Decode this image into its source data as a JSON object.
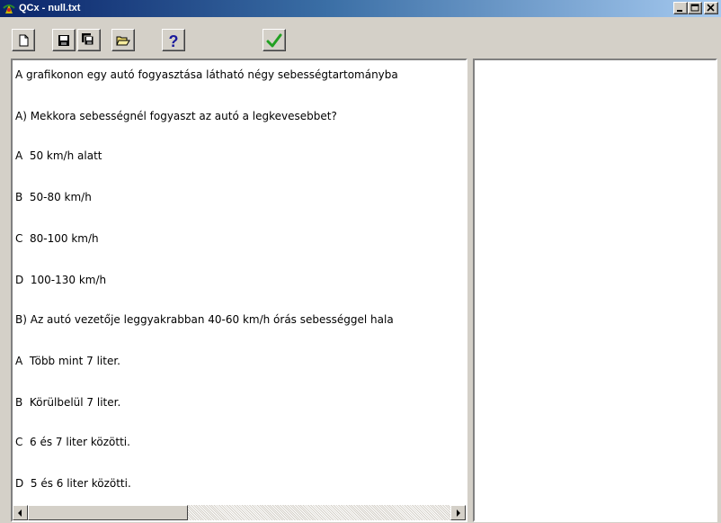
{
  "window": {
    "title": "QCx - null.txt"
  },
  "toolbar": {
    "buttons": [
      {
        "icon": "new-document-icon"
      },
      {
        "icon": "save-icon"
      },
      {
        "icon": "save-all-icon"
      },
      {
        "icon": "open-folder-icon"
      },
      {
        "icon": "help-icon",
        "color": "#1a1a9c"
      },
      {
        "icon": "checkmark-icon",
        "color": "#22a022"
      }
    ]
  },
  "editor": {
    "lines": [
      "A grafikonon egy autó fogyasztása látható négy sebességtartományba",
      "A) Mekkora sebességnél fogyaszt az autó a legkevesebbet?",
      "A  50 km/h alatt",
      "B  50-80 km/h",
      "C  80-100 km/h",
      "D  100-130 km/h",
      "B) Az autó vezetője leggyakrabban 40-60 km/h órás sebességgel hala",
      "A  Több mint 7 liter.",
      "B  Körülbelül 7 liter.",
      "C  6 és 7 liter közötti.",
      "D  5 és 6 liter közötti."
    ]
  },
  "colors": {
    "titlebar_start": "#0a246a",
    "titlebar_end": "#a6caf0",
    "face": "#d4d0c8"
  }
}
